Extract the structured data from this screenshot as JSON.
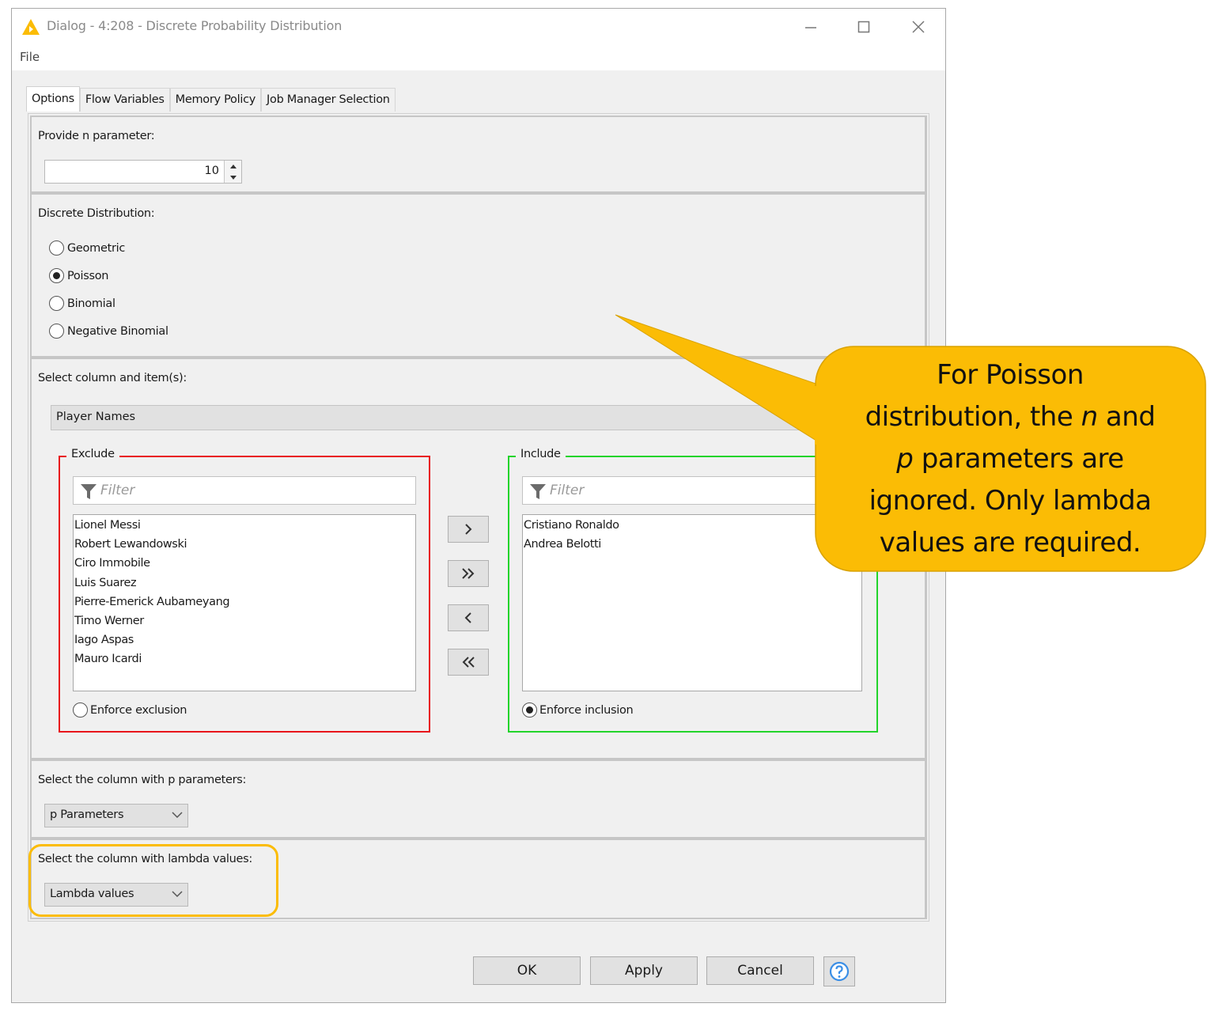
{
  "window": {
    "title": "Dialog - 4:208 - Discrete Probability Distribution",
    "icon": "knime-warning-triangle-icon",
    "controls": {
      "minimize": "minimize-icon",
      "maximize": "maximize-icon",
      "close": "close-icon"
    }
  },
  "menu": {
    "file": "File"
  },
  "tabs": [
    {
      "label": "Options",
      "active": true
    },
    {
      "label": "Flow Variables",
      "active": false
    },
    {
      "label": "Memory Policy",
      "active": false
    },
    {
      "label": "Job Manager Selection",
      "active": false
    }
  ],
  "n_parameter": {
    "label": "Provide n parameter:",
    "value": "10"
  },
  "distribution": {
    "label": "Discrete Distribution:",
    "options": [
      {
        "label": "Geometric",
        "selected": false
      },
      {
        "label": "Poisson",
        "selected": true
      },
      {
        "label": "Binomial",
        "selected": false
      },
      {
        "label": "Negative Binomial",
        "selected": false
      }
    ]
  },
  "column_select": {
    "label": "Select column and item(s):",
    "column": "Player Names",
    "exclude": {
      "title": "Exclude",
      "filter_placeholder": "Filter",
      "items": [
        "Lionel Messi",
        "Robert Lewandowski",
        "Ciro Immobile",
        "Luis Suarez",
        "Pierre-Emerick Aubameyang",
        "Timo Werner",
        "Iago Aspas",
        "Mauro Icardi"
      ],
      "enforce_label": "Enforce exclusion",
      "enforce_selected": false,
      "border_color": "#e8141a"
    },
    "include": {
      "title": "Include",
      "filter_placeholder": "Filter",
      "items": [
        "Cristiano Ronaldo",
        "Andrea Belotti"
      ],
      "enforce_label": "Enforce inclusion",
      "enforce_selected": true,
      "border_color": "#22d42a"
    },
    "move_buttons": [
      {
        "name": "add",
        "glyph": "›"
      },
      {
        "name": "add-all",
        "glyph": "»"
      },
      {
        "name": "remove",
        "glyph": "‹"
      },
      {
        "name": "remove-all",
        "glyph": "«"
      }
    ]
  },
  "p_column": {
    "label": "Select the column with p parameters:",
    "value": "p Parameters"
  },
  "lambda_column": {
    "label": "Select the column with lambda values:",
    "value": "Lambda values"
  },
  "buttons": {
    "ok": "OK",
    "apply": "Apply",
    "cancel": "Cancel",
    "help": "help-icon"
  },
  "callout": {
    "line1": "For Poisson",
    "line2_pre": "distribution, the ",
    "line2_em": "n",
    "line2_post": " and",
    "line3_em": "p",
    "line3_post": " parameters are",
    "line4": "ignored. Only lambda",
    "line5": "values are required.",
    "color": "#fbbc05",
    "highlight_color": "#fbbc05"
  }
}
